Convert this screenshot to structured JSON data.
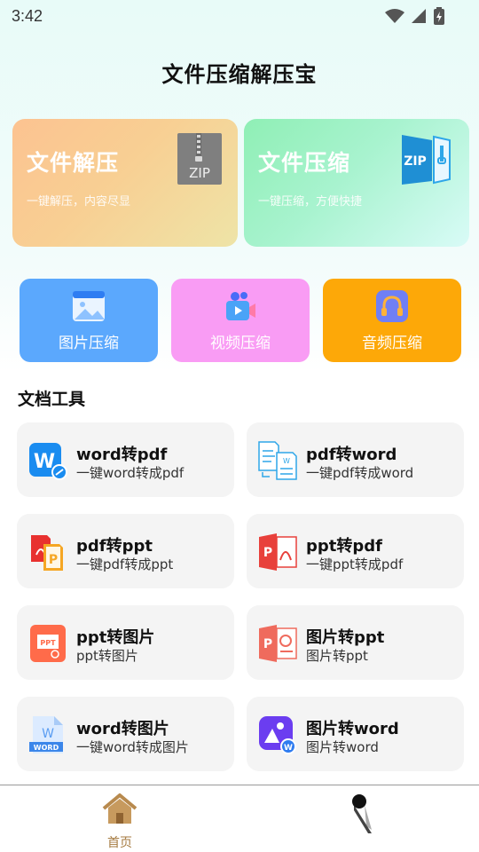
{
  "status": {
    "time": "3:42"
  },
  "page": {
    "title": "文件压缩解压宝"
  },
  "feature_cards": [
    {
      "title": "文件解压",
      "subtitle": "一键解压，内容尽显",
      "icon": "zip-file-icon"
    },
    {
      "title": "文件压缩",
      "subtitle": "一键压缩，方便快捷",
      "icon": "zip-folder-icon"
    }
  ],
  "media_tools": [
    {
      "label": "图片压缩",
      "icon": "image-icon",
      "color": "#5ba8fd"
    },
    {
      "label": "视频压缩",
      "icon": "video-camera-icon",
      "color": "#f99cf4"
    },
    {
      "label": "音频压缩",
      "icon": "headphones-icon",
      "color": "#fda808"
    }
  ],
  "doc_section": {
    "title": "文档工具"
  },
  "doc_tools": [
    {
      "title": "word转pdf",
      "subtitle": "一键word转成pdf",
      "icon": "word-to-pdf-icon"
    },
    {
      "title": "pdf转word",
      "subtitle": "一键pdf转成word",
      "icon": "pdf-to-word-icon"
    },
    {
      "title": "pdf转ppt",
      "subtitle": "一键pdf转成ppt",
      "icon": "pdf-to-ppt-icon"
    },
    {
      "title": "ppt转pdf",
      "subtitle": "一键ppt转成pdf",
      "icon": "ppt-to-pdf-icon"
    },
    {
      "title": "ppt转图片",
      "subtitle": "ppt转图片",
      "icon": "ppt-file-icon"
    },
    {
      "title": "图片转ppt",
      "subtitle": "图片转ppt",
      "icon": "powerpoint-icon"
    },
    {
      "title": "word转图片",
      "subtitle": "一键word转成图片",
      "icon": "word-file-icon"
    },
    {
      "title": "图片转word",
      "subtitle": "图片转word",
      "icon": "image-to-word-icon"
    }
  ],
  "bottom_nav": [
    {
      "label": "首页",
      "icon": "home-icon",
      "active_color": "#a57a40"
    },
    {
      "label": "",
      "icon": "user-icon"
    }
  ],
  "zip_badge": "ZIP"
}
